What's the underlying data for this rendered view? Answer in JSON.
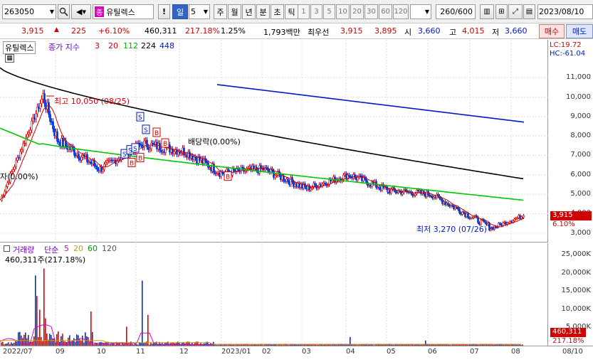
{
  "toolbar": {
    "code": "263050",
    "name": "유틸렉스",
    "name_badge": "종",
    "warn": "!",
    "period_active": "일",
    "period_count": "5",
    "periods": [
      "주",
      "월",
      "년",
      "분",
      "초",
      "틱"
    ],
    "intervals": [
      "1",
      "3",
      "5",
      "10",
      "20",
      "30",
      "60",
      "120"
    ],
    "view_count": "260",
    "view_total": "/600",
    "date": "2023/08/10"
  },
  "quote": {
    "price": "3,915",
    "change": "225",
    "change_pct": "+6.10%",
    "volume": "460,311",
    "volume_ratio": "217.18%",
    "turnover": "1.25%",
    "amount": "1,793백만",
    "best_label": "최우선",
    "ask": "3,915",
    "bid": "3,895",
    "open_label": "시",
    "open": "3,660",
    "high_label": "고",
    "high": "4,015",
    "low_label": "저",
    "low": "3,660",
    "buy_button": "매수",
    "sell_button": "매도"
  },
  "price_panel": {
    "title": "유틸렉스",
    "legend_label": "종가 지수",
    "ma": [
      "3",
      "20",
      "112",
      "224",
      "448"
    ],
    "colors": [
      "#d00000",
      "#d00000",
      "#00c800",
      "#000000",
      "#0019c8"
    ],
    "lc": "LC:19.72",
    "hc": "HC:-61.04",
    "high_note": "최고 10,050 (08/25)",
    "low_note": "최저 3,270 (07/26)",
    "dividend_note": "배당락(0.00%)",
    "left_note": "자(0.00%)",
    "price_tag": "3,915",
    "pct_tag": "6.10%",
    "yticks": [
      "11,000",
      "10,000",
      "9,000",
      "8,000",
      "7,000",
      "6,000",
      "5,000",
      "4,000",
      "3,000"
    ]
  },
  "volume_panel": {
    "title": "거래량",
    "legend_label": "단순",
    "ma": [
      "5",
      "20",
      "60",
      "120"
    ],
    "colors": [
      "#d000d0",
      "#d8b000",
      "#00a000",
      "#555555"
    ],
    "summary": "460,311주(217.18%)",
    "yticks": [
      "25,000K",
      "20,000K",
      "15,000K",
      "10,000K",
      "5,000K"
    ],
    "vol_tag": "460,311",
    "pct_tag": "217.18%"
  },
  "dates": [
    "2022/07",
    "09",
    "10",
    "11",
    "12",
    "2023/01",
    "02",
    "03",
    "04",
    "05",
    "06",
    "07",
    "08",
    "08/10"
  ],
  "chart_data": {
    "type": "line",
    "title": "유틸렉스",
    "x": [
      "2022/07",
      "2022/08/25",
      "2022/09",
      "2022/10",
      "2022/11",
      "2022/12",
      "2023/01",
      "2023/02",
      "2023/03",
      "2023/04",
      "2023/05",
      "2023/06",
      "2023/07/26",
      "2023/08/10"
    ],
    "series": [
      {
        "name": "종가",
        "values": [
          4700,
          10050,
          7800,
          6300,
          7600,
          7200,
          6100,
          6300,
          5300,
          6000,
          5200,
          5000,
          3270,
          3915
        ]
      }
    ],
    "ylim": [
      3000,
      11500
    ],
    "moving_averages": [
      "3",
      "20",
      "112",
      "224",
      "448"
    ]
  }
}
